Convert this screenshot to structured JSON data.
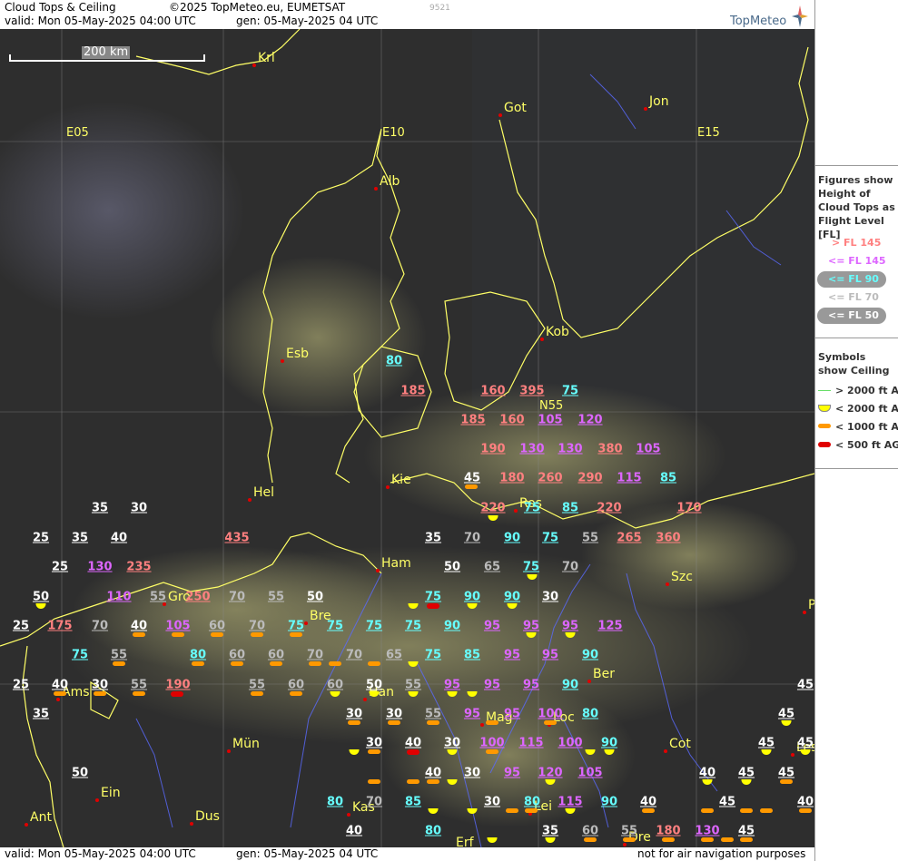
{
  "header": {
    "title": "Cloud Tops & Ceiling",
    "copyright": "©2025 TopMeteo.eu, EUMETSAT",
    "code": "9521",
    "valid": "valid:  Mon   05-May-2025   04:00 UTC",
    "gen": "gen: 05-May-2025 04 UTC",
    "logo": "TopMeteo"
  },
  "scale": {
    "label": "200 km"
  },
  "footer": {
    "valid": "valid:  Mon   05-May-2025   04:00 UTC",
    "gen": "gen: 05-May-2025 04 UTC",
    "disclaimer": "not for air navigation purposes"
  },
  "legend": {
    "figures_title": "Figures show Height of Cloud Tops as Flight Level  [FL]",
    "fl_items": [
      {
        "label": "> FL 145",
        "color": "#ff8080",
        "pill": false
      },
      {
        "label": "<= FL 145",
        "color": "#dd66ff",
        "pill": false
      },
      {
        "label": "<= FL 90",
        "color": "#66ffff",
        "pill": true
      },
      {
        "label": "<= FL 70",
        "color": "#bbbbbb",
        "pill": false
      },
      {
        "label": "<= FL 50",
        "color": "#ffffff",
        "pill": true
      }
    ],
    "symbols_title": "Symbols show Ceiling",
    "symbol_items": [
      {
        "label": "> 2000 ft AGL",
        "symbol": "green-line"
      },
      {
        "label": "< 2000 ft AGL",
        "symbol": "yellow-halfcircle"
      },
      {
        "label": "< 1000 ft AGL",
        "symbol": "orange-bar"
      },
      {
        "label": "< 500 ft AGL",
        "symbol": "red-bar"
      }
    ]
  },
  "colors": {
    "red": "#ff8080",
    "magenta": "#dd66ff",
    "cyan": "#66ffff",
    "grey": "#bbbbbb",
    "white": "#ffffff"
  },
  "grid_labels": [
    "E05",
    "E10",
    "E15",
    "N55"
  ],
  "cities": [
    "Krl",
    "Got",
    "Jon",
    "Alb",
    "Kob",
    "Esb",
    "Kie",
    "Hel",
    "Ros",
    "Ham",
    "Szc",
    "Gro",
    "Bre",
    "Ams",
    "Han",
    "Ber",
    "Mag",
    "Loc",
    "Mün",
    "Cot",
    "Les",
    "Ein",
    "Ant",
    "Dus",
    "Kas",
    "Lei",
    "Dre",
    "Erf",
    "P"
  ],
  "flight_levels": [
    {
      "v": "80",
      "c": "cyan"
    },
    {
      "v": "185",
      "c": "red"
    },
    {
      "v": "160",
      "c": "red"
    },
    {
      "v": "395",
      "c": "red"
    },
    {
      "v": "75",
      "c": "cyan"
    },
    {
      "v": "185",
      "c": "red"
    },
    {
      "v": "160",
      "c": "red"
    },
    {
      "v": "105",
      "c": "magenta"
    },
    {
      "v": "120",
      "c": "magenta"
    },
    {
      "v": "190",
      "c": "red"
    },
    {
      "v": "130",
      "c": "magenta"
    },
    {
      "v": "130",
      "c": "magenta"
    },
    {
      "v": "380",
      "c": "red"
    },
    {
      "v": "105",
      "c": "magenta"
    },
    {
      "v": "45",
      "c": "white"
    },
    {
      "v": "180",
      "c": "red"
    },
    {
      "v": "260",
      "c": "red"
    },
    {
      "v": "290",
      "c": "red"
    },
    {
      "v": "115",
      "c": "magenta"
    },
    {
      "v": "85",
      "c": "cyan"
    },
    {
      "v": "35",
      "c": "white"
    },
    {
      "v": "30",
      "c": "white"
    },
    {
      "v": "220",
      "c": "red"
    },
    {
      "v": "75",
      "c": "cyan"
    },
    {
      "v": "85",
      "c": "cyan"
    },
    {
      "v": "220",
      "c": "red"
    },
    {
      "v": "170",
      "c": "red"
    },
    {
      "v": "25",
      "c": "white"
    },
    {
      "v": "35",
      "c": "white"
    },
    {
      "v": "40",
      "c": "white"
    },
    {
      "v": "435",
      "c": "red"
    },
    {
      "v": "35",
      "c": "white"
    },
    {
      "v": "70",
      "c": "grey"
    },
    {
      "v": "90",
      "c": "cyan"
    },
    {
      "v": "75",
      "c": "cyan"
    },
    {
      "v": "55",
      "c": "grey"
    },
    {
      "v": "265",
      "c": "red"
    },
    {
      "v": "360",
      "c": "red"
    },
    {
      "v": "25",
      "c": "white"
    },
    {
      "v": "130",
      "c": "magenta"
    },
    {
      "v": "235",
      "c": "red"
    },
    {
      "v": "50",
      "c": "white"
    },
    {
      "v": "65",
      "c": "grey"
    },
    {
      "v": "75",
      "c": "cyan"
    },
    {
      "v": "70",
      "c": "grey"
    },
    {
      "v": "50",
      "c": "white"
    },
    {
      "v": "110",
      "c": "magenta"
    },
    {
      "v": "55",
      "c": "grey"
    },
    {
      "v": "250",
      "c": "red"
    },
    {
      "v": "70",
      "c": "grey"
    },
    {
      "v": "55",
      "c": "grey"
    },
    {
      "v": "50",
      "c": "white"
    },
    {
      "v": "75",
      "c": "cyan"
    },
    {
      "v": "90",
      "c": "cyan"
    },
    {
      "v": "90",
      "c": "cyan"
    },
    {
      "v": "30",
      "c": "white"
    },
    {
      "v": "25",
      "c": "white"
    },
    {
      "v": "175",
      "c": "red"
    },
    {
      "v": "70",
      "c": "grey"
    },
    {
      "v": "40",
      "c": "white"
    },
    {
      "v": "105",
      "c": "magenta"
    },
    {
      "v": "60",
      "c": "grey"
    },
    {
      "v": "70",
      "c": "grey"
    },
    {
      "v": "75",
      "c": "cyan"
    },
    {
      "v": "75",
      "c": "cyan"
    },
    {
      "v": "75",
      "c": "cyan"
    },
    {
      "v": "75",
      "c": "cyan"
    },
    {
      "v": "90",
      "c": "cyan"
    },
    {
      "v": "95",
      "c": "magenta"
    },
    {
      "v": "95",
      "c": "magenta"
    },
    {
      "v": "95",
      "c": "magenta"
    },
    {
      "v": "125",
      "c": "magenta"
    },
    {
      "v": "75",
      "c": "cyan"
    },
    {
      "v": "55",
      "c": "grey"
    },
    {
      "v": "80",
      "c": "cyan"
    },
    {
      "v": "60",
      "c": "grey"
    },
    {
      "v": "60",
      "c": "grey"
    },
    {
      "v": "70",
      "c": "grey"
    },
    {
      "v": "70",
      "c": "grey"
    },
    {
      "v": "65",
      "c": "grey"
    },
    {
      "v": "75",
      "c": "cyan"
    },
    {
      "v": "85",
      "c": "cyan"
    },
    {
      "v": "95",
      "c": "magenta"
    },
    {
      "v": "95",
      "c": "magenta"
    },
    {
      "v": "90",
      "c": "cyan"
    },
    {
      "v": "25",
      "c": "white"
    },
    {
      "v": "40",
      "c": "white"
    },
    {
      "v": "30",
      "c": "white"
    },
    {
      "v": "55",
      "c": "grey"
    },
    {
      "v": "190",
      "c": "red"
    },
    {
      "v": "55",
      "c": "grey"
    },
    {
      "v": "60",
      "c": "grey"
    },
    {
      "v": "60",
      "c": "grey"
    },
    {
      "v": "50",
      "c": "white"
    },
    {
      "v": "55",
      "c": "grey"
    },
    {
      "v": "95",
      "c": "magenta"
    },
    {
      "v": "95",
      "c": "magenta"
    },
    {
      "v": "95",
      "c": "magenta"
    },
    {
      "v": "90",
      "c": "cyan"
    },
    {
      "v": "45",
      "c": "white"
    },
    {
      "v": "35",
      "c": "white"
    },
    {
      "v": "30",
      "c": "white"
    },
    {
      "v": "30",
      "c": "white"
    },
    {
      "v": "55",
      "c": "grey"
    },
    {
      "v": "95",
      "c": "magenta"
    },
    {
      "v": "95",
      "c": "magenta"
    },
    {
      "v": "100",
      "c": "magenta"
    },
    {
      "v": "80",
      "c": "cyan"
    },
    {
      "v": "45",
      "c": "white"
    },
    {
      "v": "30",
      "c": "white"
    },
    {
      "v": "40",
      "c": "white"
    },
    {
      "v": "30",
      "c": "white"
    },
    {
      "v": "100",
      "c": "magenta"
    },
    {
      "v": "115",
      "c": "magenta"
    },
    {
      "v": "100",
      "c": "magenta"
    },
    {
      "v": "90",
      "c": "cyan"
    },
    {
      "v": "45",
      "c": "white"
    },
    {
      "v": "45",
      "c": "white"
    },
    {
      "v": "50",
      "c": "white"
    },
    {
      "v": "40",
      "c": "white"
    },
    {
      "v": "30",
      "c": "white"
    },
    {
      "v": "95",
      "c": "magenta"
    },
    {
      "v": "120",
      "c": "magenta"
    },
    {
      "v": "105",
      "c": "magenta"
    },
    {
      "v": "40",
      "c": "white"
    },
    {
      "v": "45",
      "c": "white"
    },
    {
      "v": "45",
      "c": "white"
    },
    {
      "v": "80",
      "c": "cyan"
    },
    {
      "v": "70",
      "c": "grey"
    },
    {
      "v": "85",
      "c": "cyan"
    },
    {
      "v": "30",
      "c": "white"
    },
    {
      "v": "80",
      "c": "cyan"
    },
    {
      "v": "115",
      "c": "magenta"
    },
    {
      "v": "90",
      "c": "cyan"
    },
    {
      "v": "40",
      "c": "white"
    },
    {
      "v": "45",
      "c": "white"
    },
    {
      "v": "40",
      "c": "white"
    },
    {
      "v": "40",
      "c": "white"
    },
    {
      "v": "80",
      "c": "cyan"
    },
    {
      "v": "35",
      "c": "white"
    },
    {
      "v": "60",
      "c": "grey"
    },
    {
      "v": "55",
      "c": "grey"
    },
    {
      "v": "180",
      "c": "red"
    },
    {
      "v": "130",
      "c": "magenta"
    },
    {
      "v": "45",
      "c": "white"
    }
  ],
  "ceiling_symbols": [
    {
      "s": "orange"
    },
    {
      "s": "yellow"
    },
    {
      "s": "yellow"
    },
    {
      "s": "yellow"
    },
    {
      "s": "yellow"
    },
    {
      "s": "yellow"
    },
    {
      "s": "yellow"
    },
    {
      "s": "orange"
    },
    {
      "s": "orange"
    },
    {
      "s": "red"
    },
    {
      "s": "yellow"
    },
    {
      "s": "orange"
    },
    {
      "s": "orange"
    },
    {
      "s": "orange"
    },
    {
      "s": "orange"
    },
    {
      "s": "orange"
    },
    {
      "s": "orange"
    },
    {
      "s": "yellow"
    },
    {
      "s": "yellow"
    },
    {
      "s": "orange"
    },
    {
      "s": "orange"
    },
    {
      "s": "orange"
    },
    {
      "s": "orange"
    },
    {
      "s": "orange"
    },
    {
      "s": "orange"
    },
    {
      "s": "yellow"
    },
    {
      "s": "yellow"
    },
    {
      "s": "orange"
    },
    {
      "s": "yellow"
    },
    {
      "s": "yellow"
    },
    {
      "s": "orange"
    },
    {
      "s": "orange"
    },
    {
      "s": "orange"
    },
    {
      "s": "orange"
    },
    {
      "s": "orange"
    },
    {
      "s": "red"
    },
    {
      "s": "yellow"
    },
    {
      "s": "orange"
    },
    {
      "s": "orange"
    },
    {
      "s": "yellow"
    },
    {
      "s": "orange"
    },
    {
      "s": "yellow"
    },
    {
      "s": "yellow"
    },
    {
      "s": "orange"
    },
    {
      "s": "orange"
    },
    {
      "s": "yellow"
    },
    {
      "s": "yellow"
    },
    {
      "s": "yellow"
    },
    {
      "s": "orange"
    },
    {
      "s": "yellow"
    },
    {
      "s": "yellow"
    },
    {
      "s": "orange"
    },
    {
      "s": "orange"
    },
    {
      "s": "orange"
    },
    {
      "s": "yellow"
    },
    {
      "s": "yellow"
    },
    {
      "s": "yellow"
    },
    {
      "s": "red"
    },
    {
      "s": "yellow"
    },
    {
      "s": "orange"
    },
    {
      "s": "orange"
    },
    {
      "s": "yellow"
    },
    {
      "s": "yellow"
    },
    {
      "s": "orange"
    },
    {
      "s": "orange"
    },
    {
      "s": "yellow"
    },
    {
      "s": "yellow"
    },
    {
      "s": "orange"
    },
    {
      "s": "orange"
    },
    {
      "s": "orange"
    },
    {
      "s": "orange"
    },
    {
      "s": "orange"
    },
    {
      "s": "orange"
    },
    {
      "s": "orange"
    },
    {
      "s": "orange"
    }
  ]
}
